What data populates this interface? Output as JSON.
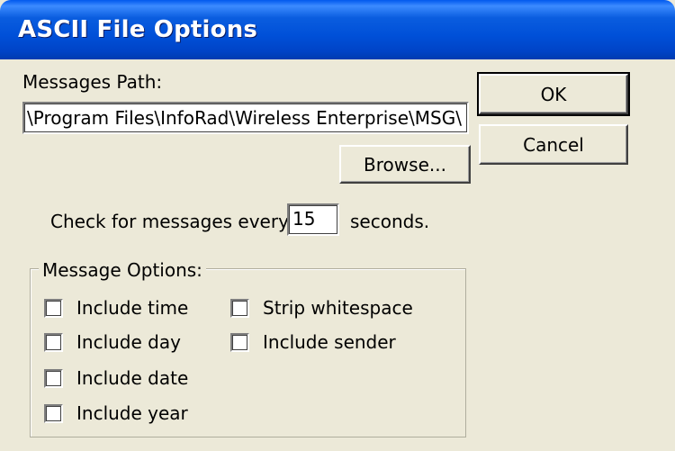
{
  "window": {
    "title": "ASCII File Options"
  },
  "path": {
    "label": "Messages Path:",
    "value": "\\Program Files\\InfoRad\\Wireless Enterprise\\MSG\\"
  },
  "buttons": {
    "ok": "OK",
    "cancel": "Cancel",
    "browse": "Browse..."
  },
  "check_interval": {
    "prefix": "Check for messages every",
    "value": "15",
    "suffix": "seconds."
  },
  "message_options": {
    "legend": "Message Options:",
    "items": [
      {
        "label": "Include time",
        "checked": false
      },
      {
        "label": "Include day",
        "checked": false
      },
      {
        "label": "Include date",
        "checked": false
      },
      {
        "label": "Include year",
        "checked": false
      },
      {
        "label": "Strip whitespace",
        "checked": false
      },
      {
        "label": "Include sender",
        "checked": false
      }
    ]
  },
  "colors": {
    "dialog_bg": "#ece9d8",
    "titlebar": "#0050d8",
    "title_text": "#ffffff"
  }
}
